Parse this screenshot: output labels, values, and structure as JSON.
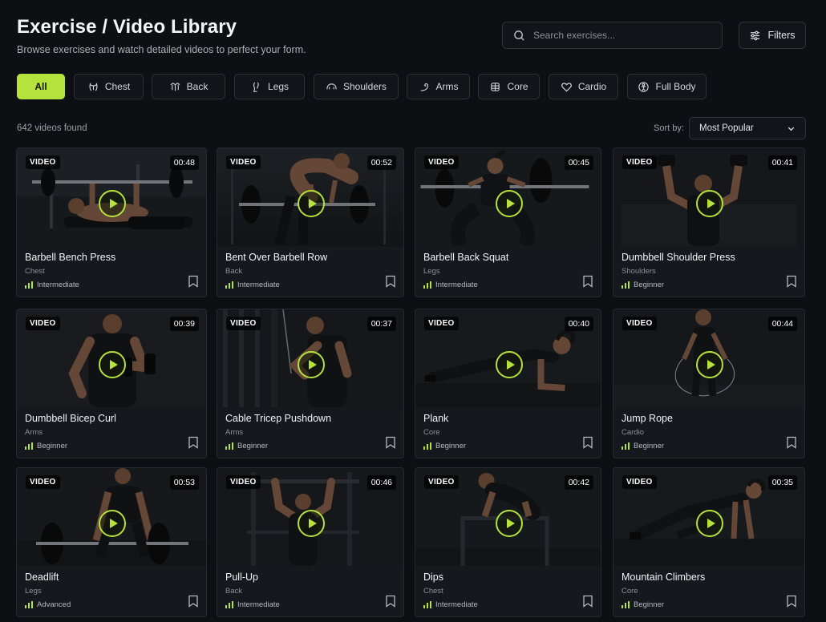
{
  "header": {
    "title": "Exercise / Video Library",
    "subtitle": "Browse exercises and watch detailed videos to perfect your form."
  },
  "search": {
    "placeholder": "Search exercises...",
    "value": "",
    "icon": "search-icon"
  },
  "filters_button": {
    "label": "Filters",
    "icon": "sliders-icon"
  },
  "categories": [
    {
      "label": "All",
      "active": true,
      "icon": ""
    },
    {
      "label": "Chest",
      "active": false,
      "icon": "chest-icon"
    },
    {
      "label": "Back",
      "active": false,
      "icon": "back-icon"
    },
    {
      "label": "Legs",
      "active": false,
      "icon": "legs-icon"
    },
    {
      "label": "Shoulders",
      "active": false,
      "icon": "shoulders-icon"
    },
    {
      "label": "Arms",
      "active": false,
      "icon": "arms-icon"
    },
    {
      "label": "Core",
      "active": false,
      "icon": "core-icon"
    },
    {
      "label": "Cardio",
      "active": false,
      "icon": "heart-icon"
    },
    {
      "label": "Full Body",
      "active": false,
      "icon": "full-body-icon"
    }
  ],
  "results": {
    "count_text": "642 videos found"
  },
  "sort": {
    "label": "Sort by:",
    "value": "Most Popular"
  },
  "colors": {
    "accent": "#b5e23c",
    "background": "#0d0f12",
    "card": "#15181c",
    "border": "#2e333a"
  },
  "videos": [
    {
      "badge": "VIDEO",
      "duration": "00:48",
      "title": "Barbell Bench Press",
      "muscle": "Chest",
      "level": "Intermediate"
    },
    {
      "badge": "VIDEO",
      "duration": "00:52",
      "title": "Bent Over Barbell Row",
      "muscle": "Back",
      "level": "Intermediate"
    },
    {
      "badge": "VIDEO",
      "duration": "00:45",
      "title": "Barbell Back Squat",
      "muscle": "Legs",
      "level": "Intermediate"
    },
    {
      "badge": "VIDEO",
      "duration": "00:41",
      "title": "Dumbbell Shoulder Press",
      "muscle": "Shoulders",
      "level": "Beginner"
    },
    {
      "badge": "VIDEO",
      "duration": "00:39",
      "title": "Dumbbell Bicep Curl",
      "muscle": "Arms",
      "level": "Beginner"
    },
    {
      "badge": "VIDEO",
      "duration": "00:37",
      "title": "Cable Tricep Pushdown",
      "muscle": "Arms",
      "level": "Beginner"
    },
    {
      "badge": "VIDEO",
      "duration": "00:40",
      "title": "Plank",
      "muscle": "Core",
      "level": "Beginner"
    },
    {
      "badge": "VIDEO",
      "duration": "00:44",
      "title": "Jump Rope",
      "muscle": "Cardio",
      "level": "Beginner"
    },
    {
      "badge": "VIDEO",
      "duration": "00:53",
      "title": "Deadlift",
      "muscle": "Legs",
      "level": "Advanced"
    },
    {
      "badge": "VIDEO",
      "duration": "00:46",
      "title": "Pull-Up",
      "muscle": "Back",
      "level": "Intermediate"
    },
    {
      "badge": "VIDEO",
      "duration": "00:42",
      "title": "Dips",
      "muscle": "Chest",
      "level": "Intermediate"
    },
    {
      "badge": "VIDEO",
      "duration": "00:35",
      "title": "Mountain Climbers",
      "muscle": "Core",
      "level": "Beginner"
    }
  ]
}
